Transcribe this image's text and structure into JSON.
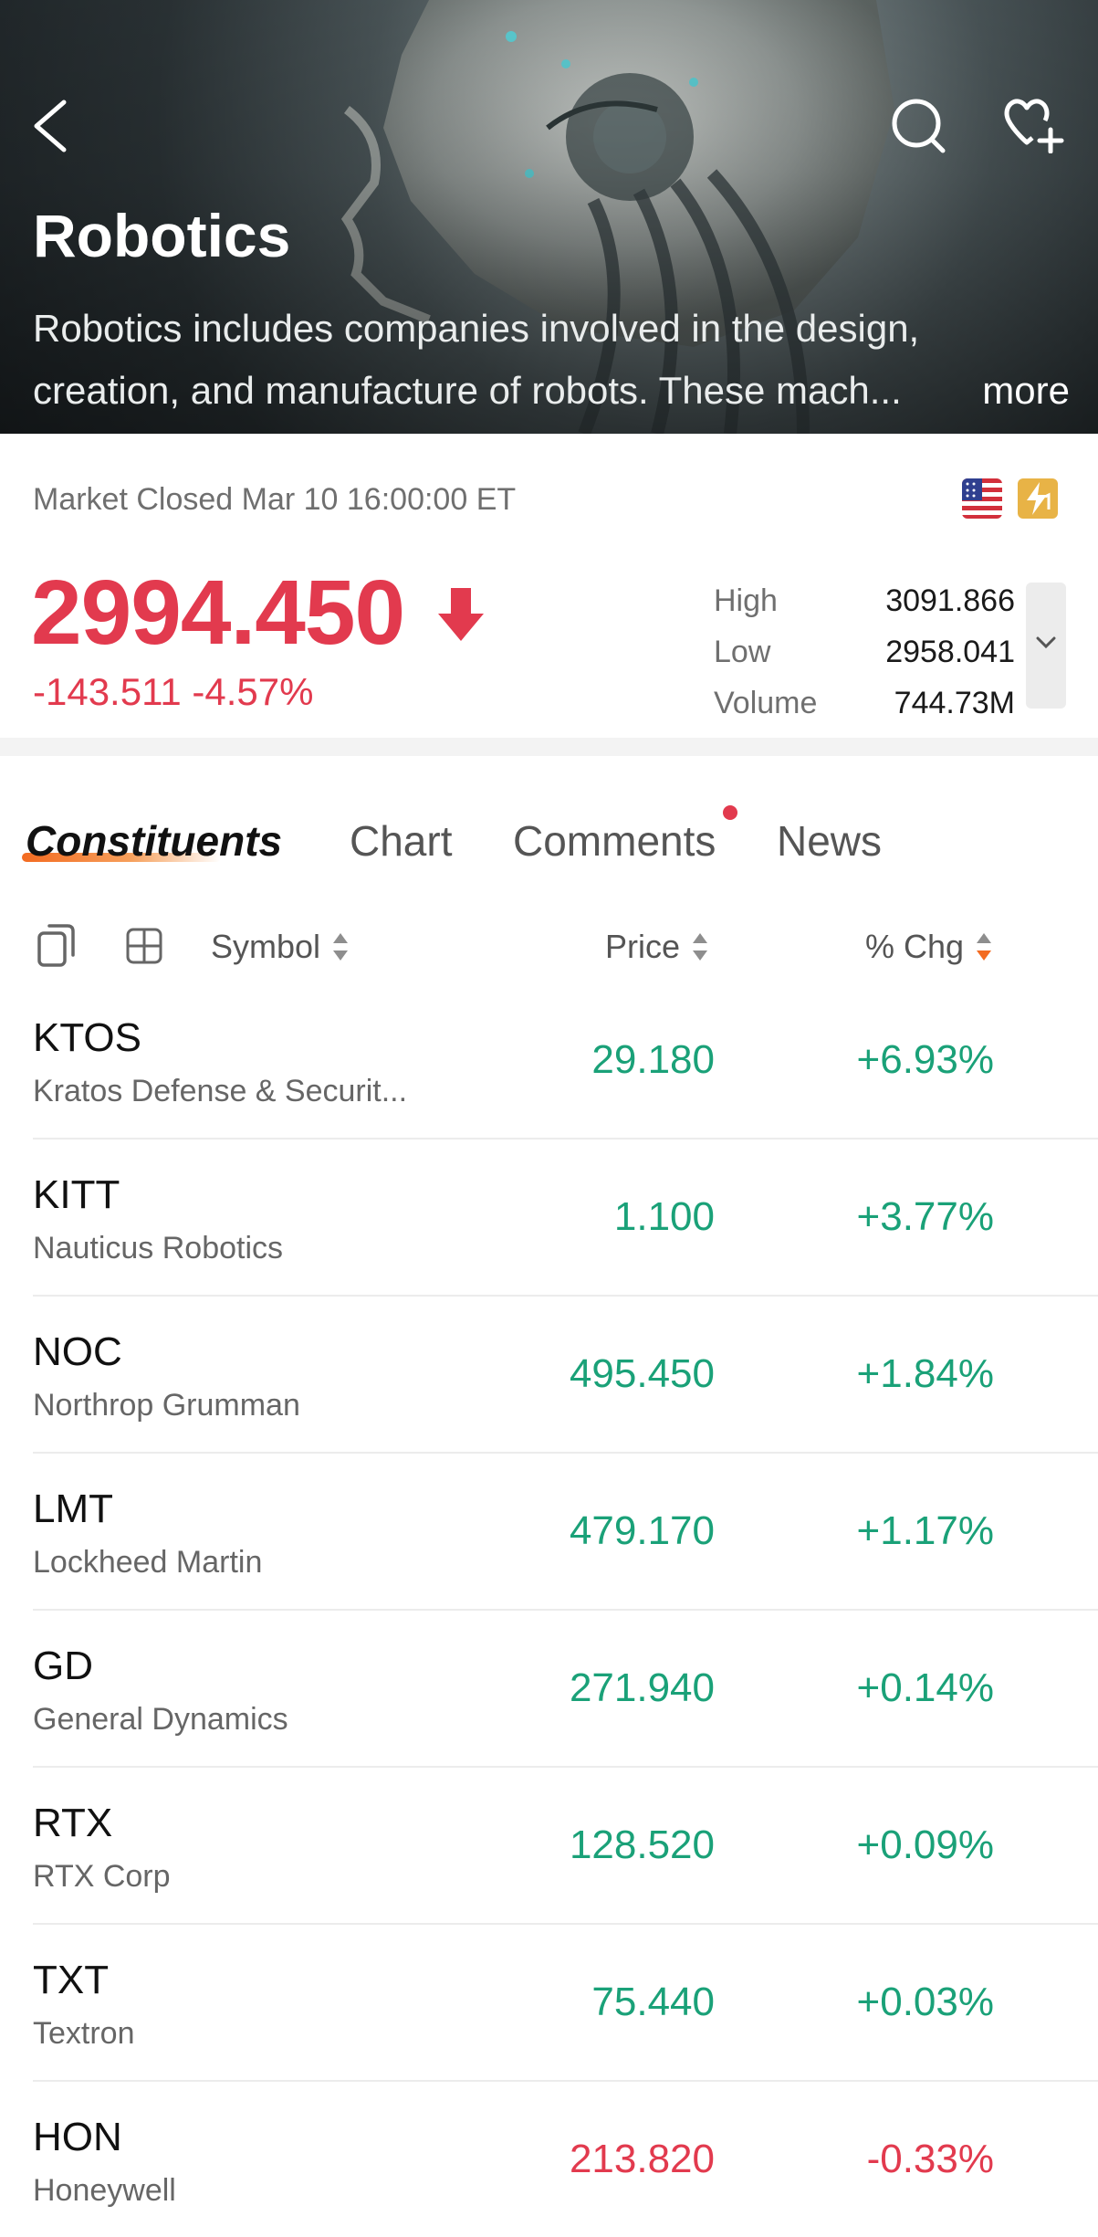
{
  "hero": {
    "title": "Robotics",
    "description": "Robotics includes companies involved in the design, creation, and manufacture of robots. These mach...",
    "more_label": "more"
  },
  "quote": {
    "market_status": "Market Closed Mar 10 16:00:00 ET",
    "price": "2994.450",
    "change": "-143.511 -4.57%",
    "direction": "down",
    "stats": [
      {
        "label": "High",
        "value": "3091.866"
      },
      {
        "label": "Low",
        "value": "2958.041"
      },
      {
        "label": "Volume",
        "value": "744.73M"
      }
    ]
  },
  "tabs": [
    {
      "label": "Constituents",
      "active": true
    },
    {
      "label": "Chart",
      "active": false
    },
    {
      "label": "Comments",
      "active": false,
      "has_notification": true
    },
    {
      "label": "News",
      "active": false
    }
  ],
  "table": {
    "columns": {
      "symbol": "Symbol",
      "price": "Price",
      "change": "% Chg"
    },
    "rows": [
      {
        "symbol": "KTOS",
        "name": "Kratos Defense & Securit...",
        "price": "29.180",
        "change": "+6.93%",
        "trend": "up"
      },
      {
        "symbol": "KITT",
        "name": "Nauticus Robotics",
        "price": "1.100",
        "change": "+3.77%",
        "trend": "up"
      },
      {
        "symbol": "NOC",
        "name": "Northrop Grumman",
        "price": "495.450",
        "change": "+1.84%",
        "trend": "up"
      },
      {
        "symbol": "LMT",
        "name": "Lockheed Martin",
        "price": "479.170",
        "change": "+1.17%",
        "trend": "up"
      },
      {
        "symbol": "GD",
        "name": "General Dynamics",
        "price": "271.940",
        "change": "+0.14%",
        "trend": "up"
      },
      {
        "symbol": "RTX",
        "name": "RTX Corp",
        "price": "128.520",
        "change": "+0.09%",
        "trend": "up"
      },
      {
        "symbol": "TXT",
        "name": "Textron",
        "price": "75.440",
        "change": "+0.03%",
        "trend": "up"
      },
      {
        "symbol": "HON",
        "name": "Honeywell",
        "price": "213.820",
        "change": "-0.33%",
        "trend": "down"
      }
    ]
  },
  "colors": {
    "up": "#1aa178",
    "down": "#e23a4e",
    "accent": "#f36b21"
  },
  "icons": [
    "back-icon",
    "search-icon",
    "heart-plus-icon",
    "us-flag-icon",
    "level1-icon",
    "down-arrow-icon",
    "chevron-down-icon",
    "copy-icon",
    "grid-icon",
    "sort-icon"
  ]
}
